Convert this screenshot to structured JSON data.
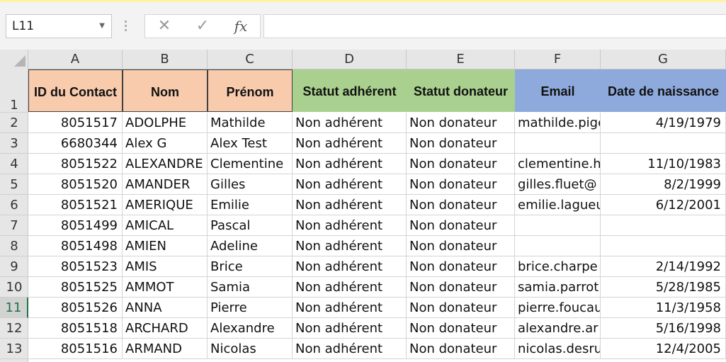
{
  "name_box": {
    "value": "L11"
  },
  "formula_bar": {
    "cancel_glyph": "✕",
    "enter_glyph": "✓",
    "function_glyph": "fx",
    "value": ""
  },
  "column_letters": [
    "A",
    "B",
    "C",
    "D",
    "E",
    "F",
    "G"
  ],
  "headers": [
    "ID du Contact",
    "Nom",
    "Prénom",
    "Statut adhérent",
    "Statut donateur",
    "Email",
    "Date de naissance"
  ],
  "header_colors": {
    "orange": "#f8cbad",
    "green": "#a9d08e",
    "blue": "#8ea9db"
  },
  "active_row": "11",
  "rows": [
    {
      "num": "1"
    },
    {
      "num": "2",
      "cells": [
        "8051517",
        "ADOLPHE",
        "Mathilde",
        "Non adhérent",
        "Non donateur",
        "mathilde.pige",
        "4/19/1979"
      ]
    },
    {
      "num": "3",
      "cells": [
        "6680344",
        "Alex G",
        "Alex Test",
        "Non adhérent",
        "Non donateur",
        "",
        ""
      ]
    },
    {
      "num": "4",
      "cells": [
        "8051522",
        "ALEXANDRE",
        "Clementine",
        "Non adhérent",
        "Non donateur",
        "clementine.h",
        "11/10/1983"
      ]
    },
    {
      "num": "5",
      "cells": [
        "8051520",
        "AMANDER",
        "Gilles",
        "Non adhérent",
        "Non donateur",
        "gilles.fluet@",
        "8/2/1999"
      ]
    },
    {
      "num": "6",
      "cells": [
        "8051521",
        "AMERIQUE",
        "Emilie",
        "Non adhérent",
        "Non donateur",
        "emilie.lagueu",
        "6/12/2001"
      ]
    },
    {
      "num": "7",
      "cells": [
        "8051499",
        "AMICAL",
        "Pascal",
        "Non adhérent",
        "Non donateur",
        "",
        ""
      ]
    },
    {
      "num": "8",
      "cells": [
        "8051498",
        "AMIEN",
        "Adeline",
        "Non adhérent",
        "Non donateur",
        "",
        ""
      ]
    },
    {
      "num": "9",
      "cells": [
        "8051523",
        "AMIS",
        "Brice",
        "Non adhérent",
        "Non donateur",
        "brice.charpe",
        "2/14/1992"
      ]
    },
    {
      "num": "10",
      "cells": [
        "8051525",
        "AMMOT",
        "Samia",
        "Non adhérent",
        "Non donateur",
        "samia.parrot",
        "5/28/1985"
      ]
    },
    {
      "num": "11",
      "cells": [
        "8051526",
        "ANNA",
        "Pierre",
        "Non adhérent",
        "Non donateur",
        "pierre.foucau",
        "11/3/1958"
      ]
    },
    {
      "num": "12",
      "cells": [
        "8051518",
        "ARCHARD",
        "Alexandre",
        "Non adhérent",
        "Non donateur",
        "alexandre.ar",
        "5/16/1998"
      ]
    },
    {
      "num": "13",
      "cells": [
        "8051516",
        "ARMAND",
        "Nicolas",
        "Non adhérent",
        "Non donateur",
        "nicolas.desru",
        "12/4/2005"
      ]
    }
  ]
}
